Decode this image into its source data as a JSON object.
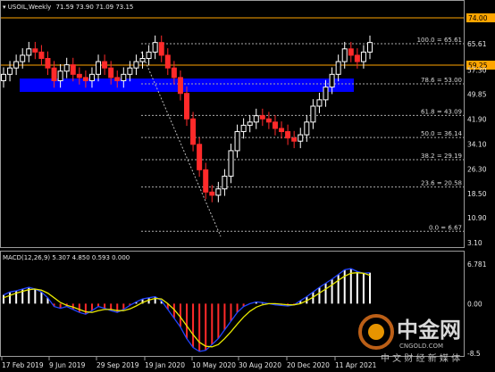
{
  "header": {
    "symbol": "USOIL,Weekly",
    "ohlc": "71.59 73.90 71.09 73.15"
  },
  "macd_header": "MACD(12,26,9) 5.307 4.850 0.593 0.000",
  "price_axis": [
    "74.00",
    "65.61",
    "59.25",
    "57.30",
    "49.85",
    "41.90",
    "34.10",
    "26.30",
    "18.50",
    "10.90",
    "3.10"
  ],
  "macd_axis": [
    "6.781",
    "0.00",
    "-8.5"
  ],
  "time_axis": [
    "17 Feb 2019",
    "9 Jun 2019",
    "29 Sep 2019",
    "19 Jan 2020",
    "10 May 2020",
    "30 Aug 2020",
    "20 Dec 2020",
    "11 Apr 2021"
  ],
  "fib_levels": [
    "100.0 = 65.61",
    "78.6 = 53.00",
    "61.8 = 43.09",
    "50.0 = 36.14",
    "38.2 = 29.19",
    "23.6 = 20.58",
    "0.0 = 6.67"
  ],
  "horizontal_lines": {
    "top": "74.00",
    "middle": "59.25"
  },
  "zone": {
    "from": 50.5,
    "to": 55.5,
    "color": "#0000ff"
  },
  "watermark": {
    "logo_text": "中金网",
    "sub": "CNGOLD.COM",
    "slogan": "中 文 财 经 新 媒 体"
  },
  "colors": {
    "bull": "#ffffff",
    "bear": "#ff2a2a",
    "macd_line": "#2244ff",
    "signal_line": "#e8e800",
    "hline": "#ffa500"
  },
  "chart_data": {
    "type": "candlestick",
    "title": "USOIL,Weekly",
    "x": [
      "2019-02-17",
      "2019-03-03",
      "2019-03-17",
      "2019-03-31",
      "2019-04-14",
      "2019-04-28",
      "2019-05-12",
      "2019-05-26",
      "2019-06-09",
      "2019-06-23",
      "2019-07-07",
      "2019-07-21",
      "2019-08-04",
      "2019-08-18",
      "2019-09-01",
      "2019-09-15",
      "2019-09-29",
      "2019-10-13",
      "2019-10-27",
      "2019-11-10",
      "2019-11-24",
      "2019-12-08",
      "2019-12-22",
      "2020-01-05",
      "2020-01-19",
      "2020-02-02",
      "2020-02-16",
      "2020-03-01",
      "2020-03-15",
      "2020-03-29",
      "2020-04-12",
      "2020-04-26",
      "2020-05-10",
      "2020-05-24",
      "2020-06-07",
      "2020-06-21",
      "2020-07-05",
      "2020-07-19",
      "2020-08-02",
      "2020-08-16",
      "2020-08-30",
      "2020-09-13",
      "2020-09-27",
      "2020-10-11",
      "2020-10-25",
      "2020-11-08",
      "2020-11-22",
      "2020-12-06",
      "2020-12-20",
      "2021-01-03",
      "2021-01-17",
      "2021-01-31",
      "2021-02-14",
      "2021-02-28",
      "2021-03-14",
      "2021-03-28",
      "2021-04-11",
      "2021-04-25",
      "2021-05-09"
    ],
    "close": [
      56,
      58,
      60,
      62,
      64,
      63,
      61,
      58,
      54,
      57,
      59,
      56,
      55,
      54,
      56,
      60,
      58,
      55,
      54,
      56,
      58,
      60,
      61,
      63,
      66,
      62,
      58,
      55,
      50,
      42,
      34,
      26,
      19,
      18,
      20,
      24,
      32,
      38,
      40,
      41,
      43,
      42,
      41,
      39,
      38,
      36,
      35,
      37,
      41,
      46,
      48,
      52,
      56,
      60,
      64,
      62,
      60,
      63,
      66
    ],
    "macd": [
      1.5,
      2.0,
      2.2,
      2.5,
      2.8,
      2.5,
      2.0,
      1.0,
      -0.5,
      -0.8,
      -0.5,
      -1.0,
      -1.5,
      -1.8,
      -1.2,
      -0.5,
      -0.8,
      -1.2,
      -1.5,
      -1.0,
      -0.3,
      0.3,
      0.8,
      1.0,
      1.2,
      0.5,
      -1.0,
      -2.5,
      -4.0,
      -6.0,
      -7.5,
      -8.2,
      -8.0,
      -7.0,
      -6.0,
      -4.5,
      -3.0,
      -1.5,
      -0.5,
      0.0,
      0.3,
      0.2,
      0.0,
      -0.2,
      -0.3,
      -0.4,
      -0.2,
      0.5,
      1.2,
      2.0,
      2.8,
      3.5,
      4.2,
      5.0,
      5.8,
      6.0,
      5.5,
      5.2,
      5.3
    ],
    "signal": [
      1.0,
      1.4,
      1.8,
      2.1,
      2.4,
      2.5,
      2.3,
      1.8,
      1.0,
      0.2,
      -0.3,
      -0.6,
      -1.0,
      -1.4,
      -1.5,
      -1.2,
      -1.0,
      -1.0,
      -1.2,
      -1.2,
      -0.9,
      -0.4,
      0.2,
      0.6,
      0.9,
      0.8,
      0.0,
      -1.0,
      -2.3,
      -3.8,
      -5.3,
      -6.6,
      -7.3,
      -7.4,
      -7.0,
      -6.0,
      -4.8,
      -3.5,
      -2.3,
      -1.3,
      -0.6,
      -0.2,
      0.0,
      0.0,
      -0.1,
      -0.2,
      -0.2,
      0.0,
      0.5,
      1.1,
      1.8,
      2.5,
      3.2,
      4.0,
      4.7,
      5.2,
      5.3,
      5.2,
      4.85
    ],
    "ylim": [
      3.1,
      76
    ],
    "macd_ylim": [
      -8.5,
      6.781
    ]
  }
}
